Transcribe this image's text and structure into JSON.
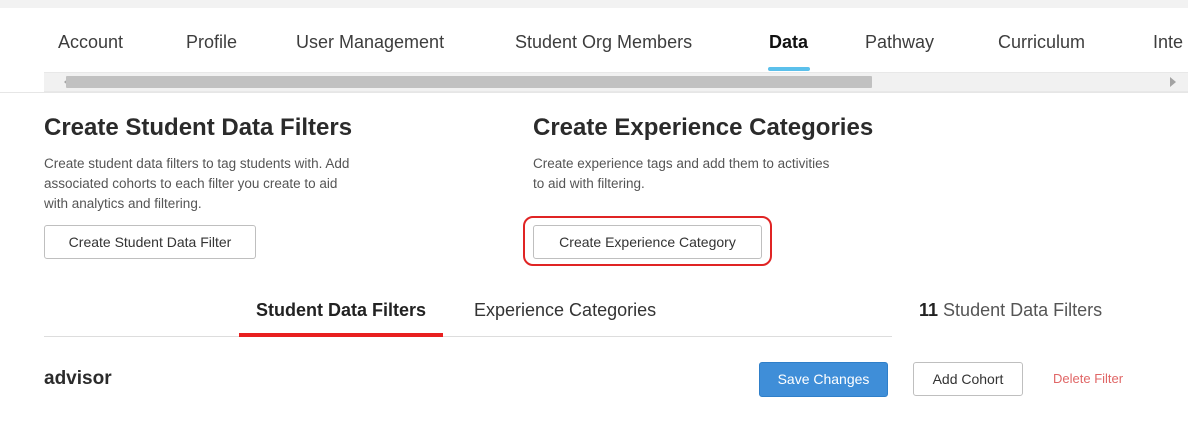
{
  "nav": {
    "tabs": [
      {
        "label": "Account"
      },
      {
        "label": "Profile"
      },
      {
        "label": "User Management"
      },
      {
        "label": "Student Org Members"
      },
      {
        "label": "Data"
      },
      {
        "label": "Pathway"
      },
      {
        "label": "Curriculum"
      },
      {
        "label": "Inte"
      }
    ],
    "active_tab": "Data"
  },
  "student_filters_section": {
    "title": "Create Student Data Filters",
    "description_lines": [
      "Create student data filters to tag students with. Add",
      "associated cohorts to each filter you create to aid",
      "with analytics and filtering."
    ],
    "button_label": "Create Student Data Filter"
  },
  "experience_section": {
    "title": "Create Experience Categories",
    "description_lines": [
      "Create experience tags and add them to activities",
      "to aid with filtering."
    ],
    "button_label": "Create Experience Category"
  },
  "sub_tabs": {
    "items": [
      {
        "label": "Student Data Filters"
      },
      {
        "label": "Experience Categories"
      }
    ],
    "active": "Student Data Filters"
  },
  "filter_count": {
    "number": "11",
    "label": "Student Data Filters"
  },
  "filter_row": {
    "name": "advisor",
    "save_label": "Save Changes",
    "add_cohort_label": "Add Cohort",
    "delete_label": "Delete Filter"
  },
  "colors": {
    "accent_blue": "#5bc0eb",
    "primary_button": "#3f8ed8",
    "active_subtab_underline": "#e81f1f",
    "highlight_border": "#e02424",
    "danger_link": "#e06666"
  }
}
